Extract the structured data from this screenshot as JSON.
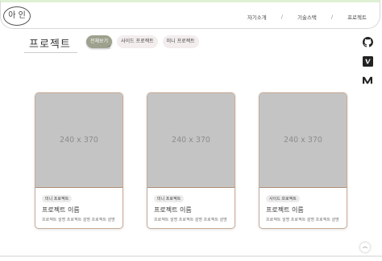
{
  "header": {
    "logo_text": "아 인",
    "nav": [
      {
        "label": "자기소개"
      },
      {
        "label": "기술스택"
      },
      {
        "label": "프로젝트"
      }
    ],
    "separator": "/"
  },
  "main": {
    "title": "프로젝트",
    "filters": [
      {
        "label": "전체보기",
        "active": true
      },
      {
        "label": "사이드 프로젝트",
        "active": false
      },
      {
        "label": "미니 프로젝트",
        "active": false
      }
    ],
    "cards": [
      {
        "thumb_text": "240 x 370",
        "tag": "미니 프로젝트",
        "title": "프로젝트 이름",
        "desc": "프로젝트 설명 프로젝트 설명 프로젝트 설명"
      },
      {
        "thumb_text": "240 x 370",
        "tag": "미니 프로젝트",
        "title": "프로젝트 이름",
        "desc": "프로젝트 설명 프로젝트 설명 프로젝트 설명"
      },
      {
        "thumb_text": "240 x 370",
        "tag": "사이드 프로젝트",
        "title": "프로젝트 이름",
        "desc": "프로젝트 설명 프로젝트 설명 프로젝트 설명"
      }
    ]
  },
  "social": [
    "github-icon",
    "velog-icon",
    "medium-icon"
  ],
  "colors": {
    "active_chip": "#9da18d",
    "chip": "#f3eded",
    "card_border": "#c8aa95",
    "header_accent": "#dff0d4"
  }
}
